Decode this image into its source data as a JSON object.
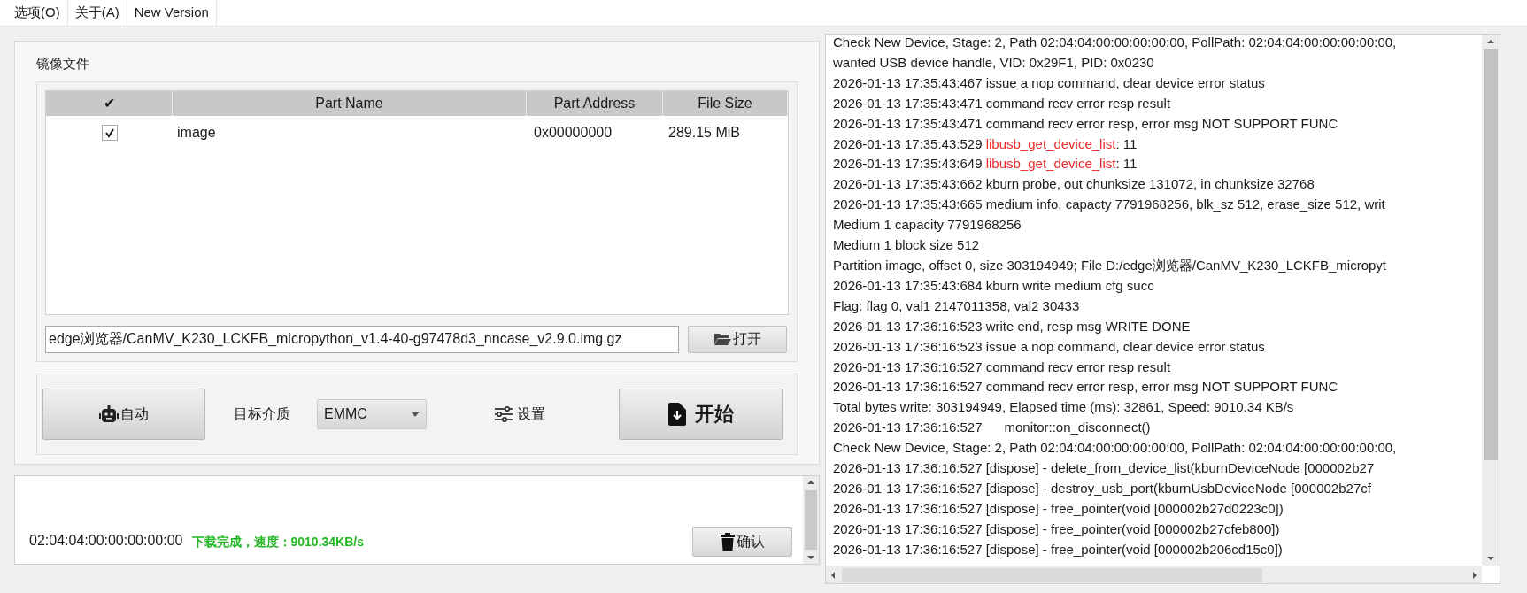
{
  "menu": [
    {
      "label": "选项(O)"
    },
    {
      "label": "关于(A)"
    },
    {
      "label": "New Version"
    }
  ],
  "image_group": {
    "title": "镜像文件",
    "table": {
      "columns": [
        "✔",
        "Part Name",
        "Part Address",
        "File Size"
      ],
      "rows": [
        {
          "checked": true,
          "name": "image",
          "address": "0x00000000",
          "size": "289.15 MiB"
        }
      ]
    },
    "file_path": "edge浏览器/CanMV_K230_LCKFB_micropython_v1.4-40-g97478d3_nncase_v2.9.0.img.gz",
    "open_button": "打开"
  },
  "controls": {
    "auto_button": "自动",
    "medium_label": "目标介质",
    "medium_value": "EMMC",
    "settings_button": "设置",
    "start_button": "开始"
  },
  "device_status": {
    "path": "02:04:04:00:00:00:00:00",
    "message": "下载完成，速度：9010.34KB/s",
    "confirm_button": "确认"
  },
  "log": [
    {
      "text": "Check New Device, Stage: 2, Path 02:04:04:00:00:00:00:00, PollPath: 02:04:04:00:00:00:00:00,"
    },
    {
      "text": "wanted USB device handle, VID: 0x29F1, PID: 0x0230"
    },
    {
      "text": "2026-01-13 17:35:43:467 issue a nop command, clear device error status"
    },
    {
      "text": "2026-01-13 17:35:43:471 command recv error resp result"
    },
    {
      "text": "2026-01-13 17:35:43:471 command recv error resp, error msg NOT SUPPORT FUNC"
    },
    {
      "segments": [
        {
          "kind": "plain",
          "text": "2026-01-13 17:35:43:529 "
        },
        {
          "kind": "error",
          "text": "libusb_get_device_list"
        },
        {
          "kind": "plain",
          "text": ": 11"
        }
      ]
    },
    {
      "segments": [
        {
          "kind": "plain",
          "text": "2026-01-13 17:35:43:649 "
        },
        {
          "kind": "error",
          "text": "libusb_get_device_list"
        },
        {
          "kind": "plain",
          "text": ": 11"
        }
      ]
    },
    {
      "text": "2026-01-13 17:35:43:662 kburn probe, out chunksize 131072, in chunksize 32768"
    },
    {
      "text": "2026-01-13 17:35:43:665 medium info, capacty 7791968256, blk_sz 512, erase_size 512, writ"
    },
    {
      "text": "Medium 1 capacity 7791968256"
    },
    {
      "text": "Medium 1 block size 512"
    },
    {
      "text": "Partition image, offset 0, size 303194949; File D:/edge浏览器/CanMV_K230_LCKFB_micropyt"
    },
    {
      "text": "2026-01-13 17:35:43:684 kburn write medium cfg succ"
    },
    {
      "text": "Flag: flag 0, val1 2147011358, val2 30433"
    },
    {
      "text": "2026-01-13 17:36:16:523 write end, resp msg WRITE DONE"
    },
    {
      "text": "2026-01-13 17:36:16:523 issue a nop command, clear device error status"
    },
    {
      "text": "2026-01-13 17:36:16:527 command recv error resp result"
    },
    {
      "text": "2026-01-13 17:36:16:527 command recv error resp, error msg NOT SUPPORT FUNC"
    },
    {
      "text": "Total bytes write: 303194949, Elapsed time (ms): 32861, Speed: 9010.34 KB/s"
    },
    {
      "text": "2026-01-13 17:36:16:527      monitor::on_disconnect()"
    },
    {
      "text": "Check New Device, Stage: 2, Path 02:04:04:00:00:00:00:00, PollPath: 02:04:04:00:00:00:00:00,"
    },
    {
      "text": "2026-01-13 17:36:16:527 [dispose] - delete_from_device_list(kburnDeviceNode [000002b27"
    },
    {
      "text": "2026-01-13 17:36:16:527 [dispose] - destroy_usb_port(kburnUsbDeviceNode [000002b27cf"
    },
    {
      "text": "2026-01-13 17:36:16:527 [dispose] - free_pointer(void [000002b27d0223c0])"
    },
    {
      "text": "2026-01-13 17:36:16:527 [dispose] - free_pointer(void [000002b27cfeb800])"
    },
    {
      "text": "2026-01-13 17:36:16:527 [dispose] - free_pointer(void [000002b206cd15c0])"
    }
  ]
}
